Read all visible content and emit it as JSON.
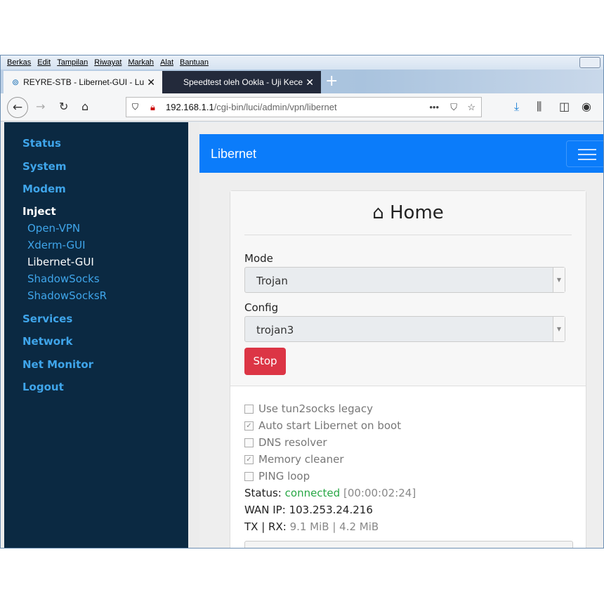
{
  "menu": [
    "Berkas",
    "Edit",
    "Tampilan",
    "Riwayat",
    "Markah",
    "Alat",
    "Bantuan"
  ],
  "tabs": [
    {
      "title": "REYRE-STB - Libernet-GUI - Lu"
    },
    {
      "title": "Speedtest oleh Ookla - Uji Kece"
    }
  ],
  "url": {
    "host": "192.168.1.1",
    "path": "/cgi-bin/luci/admin/vpn/libernet"
  },
  "sidebar": {
    "items": [
      "Status",
      "System",
      "Modem",
      "Inject",
      "Services",
      "Network",
      "Net Monitor",
      "Logout"
    ],
    "inject_sub": [
      "Open-VPN",
      "Xderm-GUI",
      "Libernet-GUI",
      "ShadowSocks",
      "ShadowSocksR"
    ]
  },
  "app": {
    "brand": "Libernet",
    "title": "Home",
    "mode_label": "Mode",
    "mode_value": "Trojan",
    "config_label": "Config",
    "config_value": "trojan3",
    "stop_label": "Stop"
  },
  "options": [
    {
      "label": "Use tun2socks legacy",
      "checked": false
    },
    {
      "label": "Auto start Libernet on boot",
      "checked": true
    },
    {
      "label": "DNS resolver",
      "checked": false
    },
    {
      "label": "Memory cleaner",
      "checked": true
    },
    {
      "label": "PING loop",
      "checked": false
    }
  ],
  "status": {
    "status_label": "Status:",
    "status_value": "connected",
    "uptime": "[00:00:02:24]",
    "wan_label": "WAN IP:",
    "wan_ip": "103.253.24.216",
    "txrx_label": "TX | RX:",
    "txrx_value": "9.1 MiB | 4.2 MiB"
  }
}
